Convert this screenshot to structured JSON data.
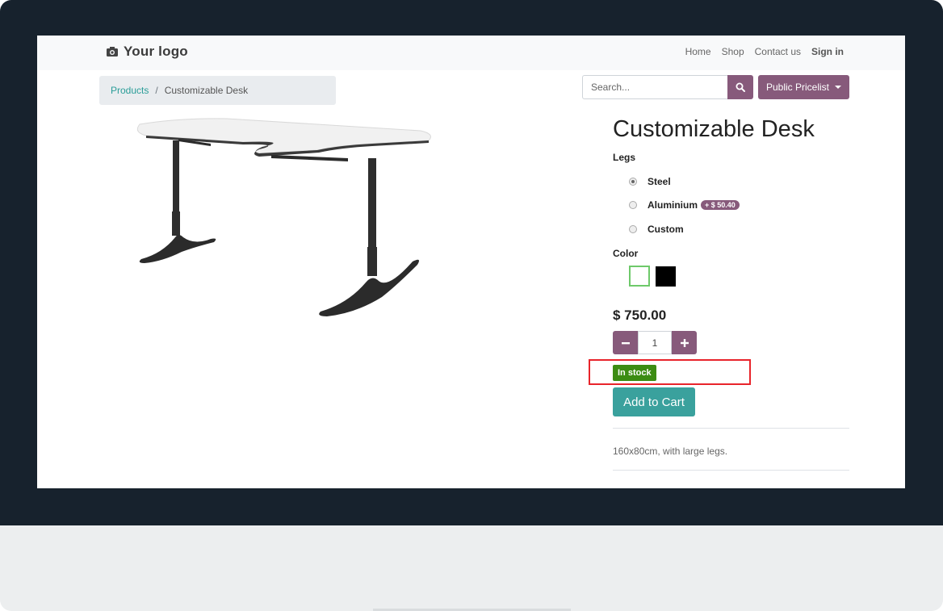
{
  "header": {
    "logo_text": "Your logo",
    "nav": [
      "Home",
      "Shop",
      "Contact us",
      "Sign in"
    ]
  },
  "breadcrumb": {
    "parent": "Products",
    "separator": "/",
    "current": "Customizable Desk"
  },
  "search": {
    "placeholder": "Search..."
  },
  "pricelist": {
    "label": "Public Pricelist"
  },
  "product": {
    "title": "Customizable Desk",
    "legs_label": "Legs",
    "legs_options": [
      {
        "label": "Steel",
        "selected": true
      },
      {
        "label": "Aluminium",
        "extra": "+ $ 50.40",
        "selected": false
      },
      {
        "label": "Custom",
        "selected": false
      }
    ],
    "color_label": "Color",
    "colors": [
      {
        "name": "white",
        "hex": "#ffffff",
        "selected": true
      },
      {
        "name": "black",
        "hex": "#000000",
        "selected": false
      }
    ],
    "price": "$ 750.00",
    "quantity": "1",
    "stock_status": "In stock",
    "add_to_cart": "Add to Cart",
    "description": "160x80cm, with large legs."
  },
  "colors": {
    "brand": "#875a7b",
    "accent": "#3aa19d",
    "stock": "#3c8c13",
    "highlight": "#e8242b"
  }
}
